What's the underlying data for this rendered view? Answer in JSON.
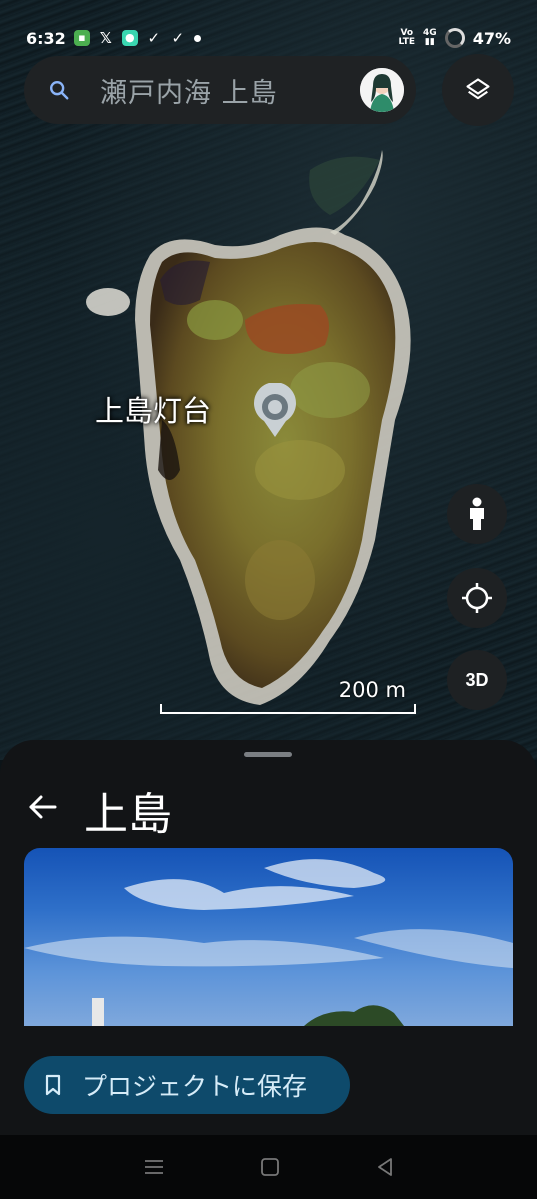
{
  "status_bar": {
    "time": "6:32",
    "network": "Vo LTE",
    "signal": "4G",
    "battery": "47%",
    "icons": [
      "shopping-app-icon",
      "x-icon",
      "chat-app-icon",
      "check-icon",
      "check-icon",
      "dot-icon"
    ]
  },
  "search": {
    "query": "瀬戸内海 上島",
    "search_icon": "search-icon",
    "avatar": "user-avatar"
  },
  "map": {
    "place_label": "上島灯台",
    "pin_icon": "location-pin-icon",
    "scale_label": "200 m",
    "buttons": {
      "layers": "layers-icon",
      "street_view": "pegman-icon",
      "my_location": "crosshair-icon",
      "three_d": "3D"
    }
  },
  "sheet": {
    "title": "上島",
    "back_icon": "back-arrow-icon",
    "save_label": "プロジェクトに保存",
    "save_icon": "bookmark-icon"
  },
  "colors": {
    "surface": "#1f2224",
    "sheet": "#121416",
    "save_button": "#0e4a6b",
    "save_text": "#d6ecf8"
  }
}
